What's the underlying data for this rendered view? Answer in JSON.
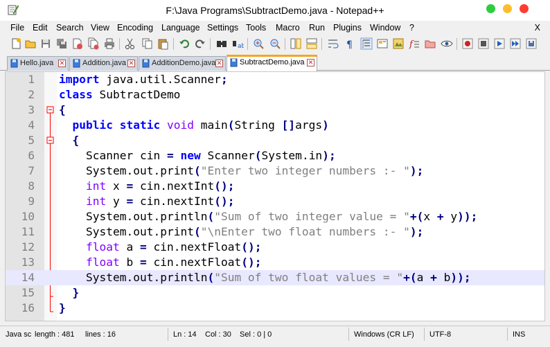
{
  "window": {
    "title": "F:\\Java Programs\\SubtractDemo.java - Notepad++",
    "controls": [
      "minimize",
      "maximize",
      "close"
    ]
  },
  "menu": {
    "items": [
      "File",
      "Edit",
      "Search",
      "View",
      "Encoding",
      "Language",
      "Settings",
      "Tools",
      "Macro",
      "Run",
      "Plugins",
      "Window",
      "?"
    ],
    "close_label": "X"
  },
  "toolbar": {
    "buttons": [
      "new-file",
      "open-file",
      "save",
      "save-all",
      "close",
      "close-all",
      "print",
      "cut",
      "copy",
      "paste",
      "undo",
      "redo",
      "find",
      "replace",
      "zoom-in",
      "zoom-out",
      "sync-vertical",
      "sync-horizontal",
      "word-wrap",
      "show-all-chars",
      "indent-guide",
      "user-defined-language",
      "document-map",
      "function-list",
      "folder-as-workspace",
      "monitoring",
      "record-macro",
      "stop-recording",
      "playback-macro",
      "run-macro-multiple",
      "save-macro"
    ]
  },
  "tabs": [
    {
      "label": "Hello.java",
      "active": false
    },
    {
      "label": "Addition.java",
      "active": false
    },
    {
      "label": "AdditionDemo.java",
      "active": false
    },
    {
      "label": "SubtractDemo.java",
      "active": true
    }
  ],
  "editor": {
    "current_line": 14,
    "lines": [
      {
        "n": "1",
        "code": "import java.util.Scanner;"
      },
      {
        "n": "2",
        "code": "class SubtractDemo"
      },
      {
        "n": "3",
        "code": "{"
      },
      {
        "n": "4",
        "code": "  public static void main(String []args)"
      },
      {
        "n": "5",
        "code": "  {"
      },
      {
        "n": "6",
        "code": "    Scanner cin = new Scanner(System.in);"
      },
      {
        "n": "7",
        "code": "    System.out.print(\"Enter two integer numbers :- \");"
      },
      {
        "n": "8",
        "code": "    int x = cin.nextInt();"
      },
      {
        "n": "9",
        "code": "    int y = cin.nextInt();"
      },
      {
        "n": "10",
        "code": "    System.out.println(\"Sum of two integer value = \"+(x + y));"
      },
      {
        "n": "11",
        "code": "    System.out.print(\"\\nEnter two float numbers :- \");"
      },
      {
        "n": "12",
        "code": "    float a = cin.nextFloat();"
      },
      {
        "n": "13",
        "code": "    float b = cin.nextFloat();"
      },
      {
        "n": "14",
        "code": "    System.out.println(\"Sum of two float values = \"+(a + b));"
      },
      {
        "n": "15",
        "code": "  }"
      },
      {
        "n": "16",
        "code": "}"
      }
    ]
  },
  "status": {
    "file_type": "Java sc",
    "length": "length : 481",
    "lines": "lines : 16",
    "position": "Ln : 14",
    "column": "Col : 30",
    "selection": "Sel : 0 | 0",
    "eol": "Windows (CR LF)",
    "encoding": "UTF-8",
    "insert_mode": "INS"
  },
  "colors": {
    "keyword": "#0000ff",
    "type": "#8000ff",
    "string": "#808080",
    "operator": "#000080",
    "current_line": "#e8e8ff",
    "active_tab_accent": "#f5a623",
    "fold_marker": "#ff0000"
  }
}
